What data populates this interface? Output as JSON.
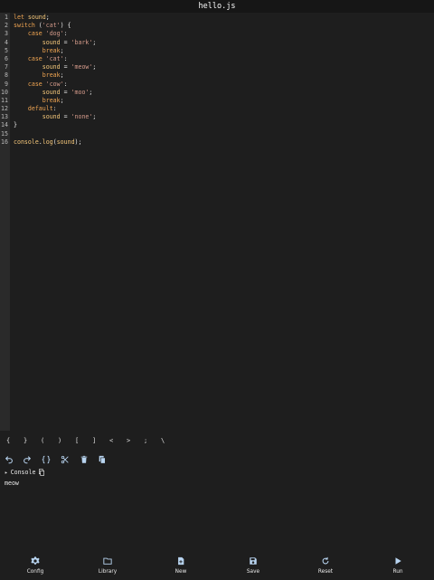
{
  "title": "hello.js",
  "editor": {
    "line_numbers": [
      "1",
      "2",
      "3",
      "4",
      "5",
      "6",
      "7",
      "8",
      "9",
      "10",
      "11",
      "12",
      "13",
      "14",
      "15",
      "16"
    ],
    "lines": [
      [
        {
          "t": "let ",
          "c": "kw"
        },
        {
          "t": "sound",
          "c": "var"
        },
        {
          "t": ";",
          "c": "plain"
        }
      ],
      [
        {
          "t": "switch ",
          "c": "kw"
        },
        {
          "t": "(",
          "c": "plain"
        },
        {
          "t": "'cat'",
          "c": "str"
        },
        {
          "t": ") {",
          "c": "plain"
        }
      ],
      [
        {
          "t": "    case ",
          "c": "kw"
        },
        {
          "t": "'dog'",
          "c": "str"
        },
        {
          "t": ":",
          "c": "plain"
        }
      ],
      [
        {
          "t": "        sound",
          "c": "var"
        },
        {
          "t": " = ",
          "c": "plain"
        },
        {
          "t": "'bark'",
          "c": "str"
        },
        {
          "t": ";",
          "c": "plain"
        }
      ],
      [
        {
          "t": "        break",
          "c": "kw"
        },
        {
          "t": ";",
          "c": "plain"
        }
      ],
      [
        {
          "t": "    case ",
          "c": "kw"
        },
        {
          "t": "'cat'",
          "c": "str"
        },
        {
          "t": ":",
          "c": "plain"
        }
      ],
      [
        {
          "t": "        sound",
          "c": "var"
        },
        {
          "t": " = ",
          "c": "plain"
        },
        {
          "t": "'meow'",
          "c": "str"
        },
        {
          "t": ";",
          "c": "plain"
        }
      ],
      [
        {
          "t": "        break",
          "c": "kw"
        },
        {
          "t": ";",
          "c": "plain"
        }
      ],
      [
        {
          "t": "    case ",
          "c": "kw"
        },
        {
          "t": "'cow'",
          "c": "str"
        },
        {
          "t": ":",
          "c": "plain"
        }
      ],
      [
        {
          "t": "        sound",
          "c": "var"
        },
        {
          "t": " = ",
          "c": "plain"
        },
        {
          "t": "'moo'",
          "c": "str"
        },
        {
          "t": ";",
          "c": "plain"
        }
      ],
      [
        {
          "t": "        break",
          "c": "kw"
        },
        {
          "t": ";",
          "c": "plain"
        }
      ],
      [
        {
          "t": "    default",
          "c": "kw"
        },
        {
          "t": ":",
          "c": "plain"
        }
      ],
      [
        {
          "t": "        sound",
          "c": "var"
        },
        {
          "t": " = ",
          "c": "plain"
        },
        {
          "t": "'none'",
          "c": "str"
        },
        {
          "t": ";",
          "c": "plain"
        }
      ],
      [
        {
          "t": "}",
          "c": "plain"
        }
      ],
      [],
      [
        {
          "t": "console",
          "c": "var"
        },
        {
          "t": ".",
          "c": "plain"
        },
        {
          "t": "log",
          "c": "fn"
        },
        {
          "t": "(",
          "c": "plain"
        },
        {
          "t": "sound",
          "c": "var"
        },
        {
          "t": ");",
          "c": "plain"
        }
      ]
    ]
  },
  "symbols": [
    "{",
    "}",
    "(",
    ")",
    "[",
    "]",
    "<",
    ">",
    ";",
    "\\"
  ],
  "tools": [
    "undo-icon",
    "redo-icon",
    "format-braces-icon",
    "cut-icon",
    "delete-icon",
    "copy-icon"
  ],
  "console": {
    "label": "Console",
    "output": "meow"
  },
  "nav": [
    {
      "label": "Config",
      "icon": "gear-icon"
    },
    {
      "label": "Library",
      "icon": "folder-icon"
    },
    {
      "label": "New",
      "icon": "new-file-icon"
    },
    {
      "label": "Save",
      "icon": "save-icon"
    },
    {
      "label": "Reset",
      "icon": "reset-icon"
    },
    {
      "label": "Run",
      "icon": "play-icon"
    }
  ],
  "colors": {
    "background": "#1e1e1e",
    "keyword": "#f0a552",
    "variable": "#f5c77a",
    "string": "#d49a8a",
    "icon": "#b8d4f0"
  }
}
